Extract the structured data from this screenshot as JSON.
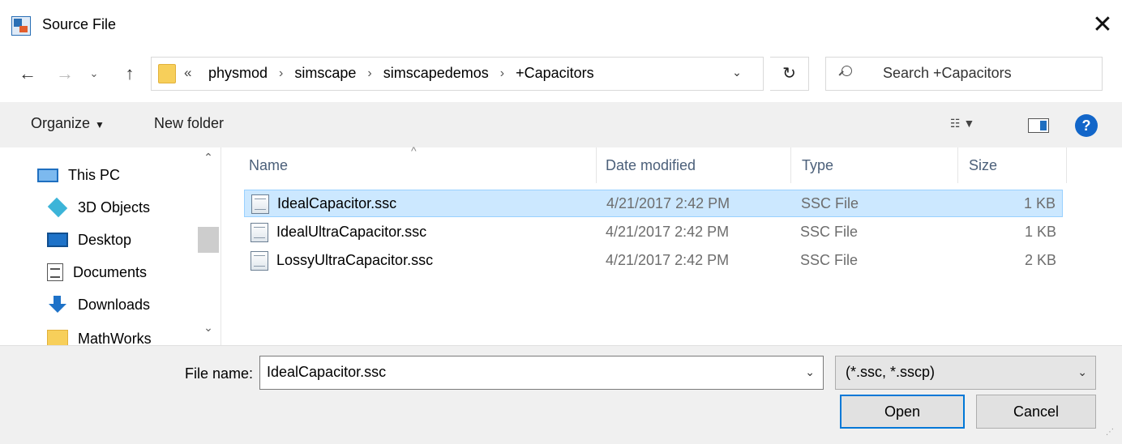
{
  "window": {
    "title": "Source File",
    "close_glyph": "✕"
  },
  "nav": {
    "back_glyph": "←",
    "forward_glyph": "→",
    "recent_glyph": "⌄",
    "up_glyph": "↑",
    "refresh_glyph": "↻"
  },
  "address": {
    "overflow": "«",
    "breadcrumbs": [
      "physmod",
      "simscape",
      "simscapedemos",
      "+Capacitors"
    ],
    "separator": "›"
  },
  "search": {
    "placeholder": "Search +Capacitors"
  },
  "toolbar": {
    "organize_label": "Organize",
    "new_folder_label": "New folder",
    "help_glyph": "?"
  },
  "sidebar": {
    "items": [
      {
        "label": "This PC",
        "icon": "computer-icon"
      },
      {
        "label": "3D Objects",
        "icon": "cube-icon"
      },
      {
        "label": "Desktop",
        "icon": "desktop-icon"
      },
      {
        "label": "Documents",
        "icon": "documents-icon"
      },
      {
        "label": "Downloads",
        "icon": "download-icon"
      },
      {
        "label": "MathWorks",
        "icon": "folder-icon"
      }
    ]
  },
  "file_list": {
    "columns": {
      "name": "Name",
      "date": "Date modified",
      "type": "Type",
      "size": "Size"
    },
    "rows": [
      {
        "name": "IdealCapacitor.ssc",
        "date": "4/21/2017 2:42 PM",
        "type": "SSC File",
        "size": "1 KB",
        "selected": true
      },
      {
        "name": "IdealUltraCapacitor.ssc",
        "date": "4/21/2017 2:42 PM",
        "type": "SSC File",
        "size": "1 KB",
        "selected": false
      },
      {
        "name": "LossyUltraCapacitor.ssc",
        "date": "4/21/2017 2:42 PM",
        "type": "SSC File",
        "size": "2 KB",
        "selected": false
      }
    ]
  },
  "footer": {
    "filename_label": "File name:",
    "filename_value": "IdealCapacitor.ssc",
    "filter_value": "(*.ssc, *.sscp)",
    "open_label": "Open",
    "cancel_label": "Cancel"
  },
  "colors": {
    "selection_bg": "#cce8ff",
    "selection_border": "#99d1ff",
    "accent": "#0078d7",
    "header_text": "#4c607a"
  }
}
